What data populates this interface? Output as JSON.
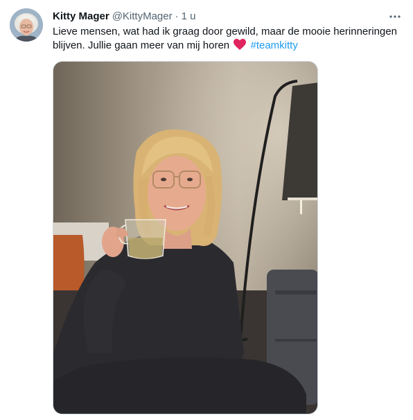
{
  "tweet": {
    "display_name": "Kitty Mager",
    "handle": "@KittyMager",
    "separator": "·",
    "time": "1 u",
    "text_before": "Lieve mensen, wat had ik graag door gewild, maar de mooie herinneringen blijven. Jullie gaan meer van mij horen",
    "emoji": "red-heart",
    "hashtag": "#teamkitty"
  },
  "icons": {
    "more": "more-horizontal-icon",
    "heart": "heart-icon"
  },
  "colors": {
    "link": "#1d9bf0",
    "secondary_text": "#536471",
    "heart": "#e0245e"
  },
  "media": {
    "type": "photo"
  }
}
